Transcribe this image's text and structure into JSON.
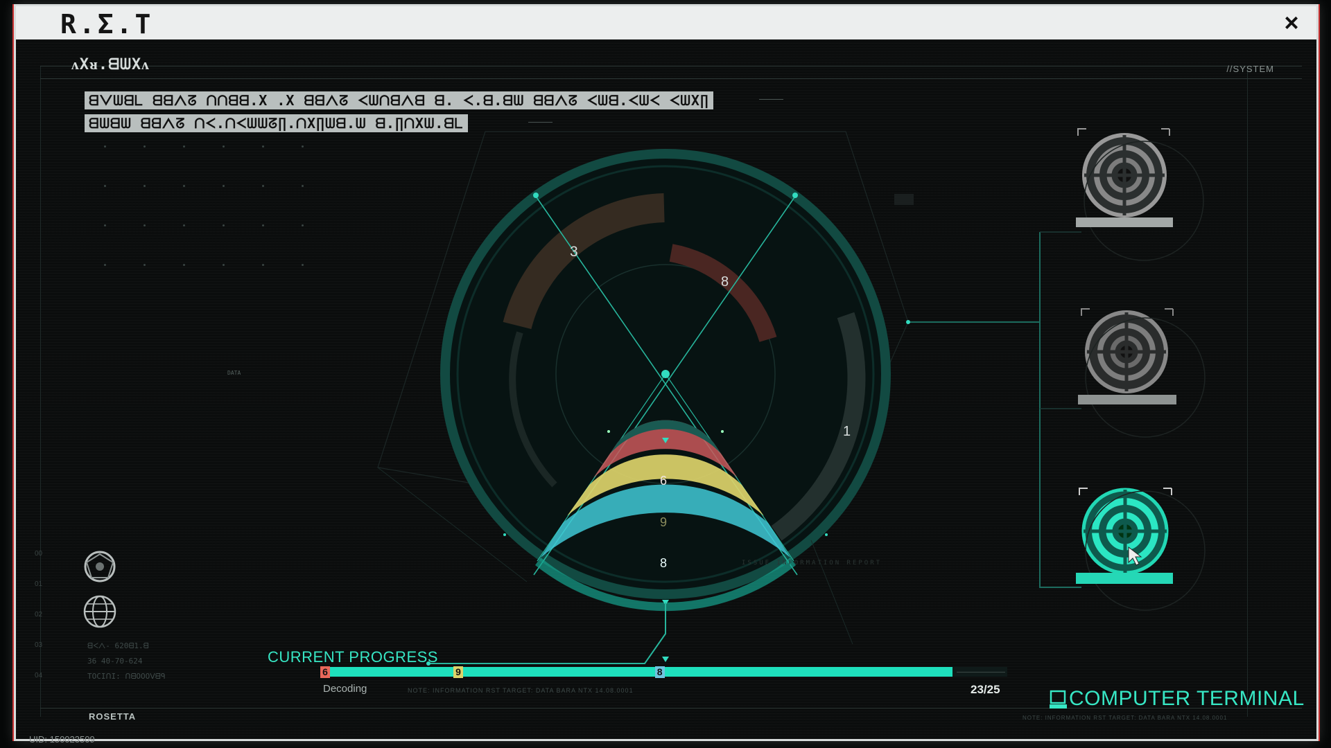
{
  "window": {
    "logo": "R.Σ.T",
    "close_icon": "×"
  },
  "header": {
    "title": "ᴧXᴚ.ᗺᗯXᴧ",
    "system_label": "//SYSTEM",
    "code_lines": [
      "ᗺᐯᗯᗺᒪ ᗺᗺᐱᘔ ᑎᑎᗺᗺ.X .X ᗺᗺᐱᘔ ᐸᗯᑎᗺᐱᗺ ᗺ. ᐸ.ᗺ.ᗺᗯ ᗺᗺᐱᘔ ᐸᗯᗺ.ᐸᗯᐸ ᐸᗯX∏",
      "ᗺᗯᗺᗯ ᗺᗺᐱᘔ ᑎᐸ.ᑎᐸᗯᗯᘔ∏.ᑎX∏ᗯᗺ.ᗯ ᗺ.∏ᑎXᗯ.ᗺᒪ"
    ]
  },
  "radar": {
    "segment_labels": [
      "3",
      "8",
      "1"
    ],
    "wedge_bands": [
      {
        "label": "6",
        "color": "#e8675a"
      },
      {
        "label": "9",
        "color": "#dcd36a"
      },
      {
        "label": "8",
        "color": "#40c9d6"
      }
    ],
    "faint_labels": [
      "DATA",
      "ISSUE INFORMATION REPORT"
    ]
  },
  "targets": [
    {
      "name": "target-1",
      "state": "inactive"
    },
    {
      "name": "target-2",
      "state": "inactive"
    },
    {
      "name": "target-3",
      "state": "active"
    }
  ],
  "left_panel": {
    "side_numbers": [
      "00",
      "01",
      "02",
      "03",
      "04"
    ],
    "info_lines": [
      "ᗺᐸᐱ- 620ᗺ1.ᗺ",
      "36 40-70-624",
      "TOCIᑎI: ᑎᗺOOOᐯᗺᑫ"
    ],
    "rosetta": "ROSETTA",
    "icons": [
      "lattice-globe-icon",
      "globe-icon"
    ]
  },
  "progress": {
    "label": "CURRENT PROGRESS",
    "status": "Decoding",
    "ratio": "23/25",
    "fill_fraction": 0.92,
    "markers": [
      {
        "label": "6",
        "color": "#e8675a",
        "position": 0.0
      },
      {
        "label": "9",
        "color": "#dcd36a",
        "position": 0.195
      },
      {
        "label": "8",
        "color": "#6fc3de",
        "position": 0.49
      }
    ],
    "note": "NOTE: INFORMATION RST TARGET: DATA  BARA NTX 14.08.0001"
  },
  "terminal": {
    "label": "COMPUTER TERMINAL",
    "note": "NOTE: INFORMATION RST TARGET: DATA  BARA NTX 14.08.0001"
  },
  "footer": {
    "uid": "UID: 150023509"
  },
  "colors": {
    "accent": "#1ee0bd",
    "ring": "#0f3d36",
    "red": "#e8675a",
    "yellow": "#dcd36a",
    "cyan": "#40c9d6"
  }
}
